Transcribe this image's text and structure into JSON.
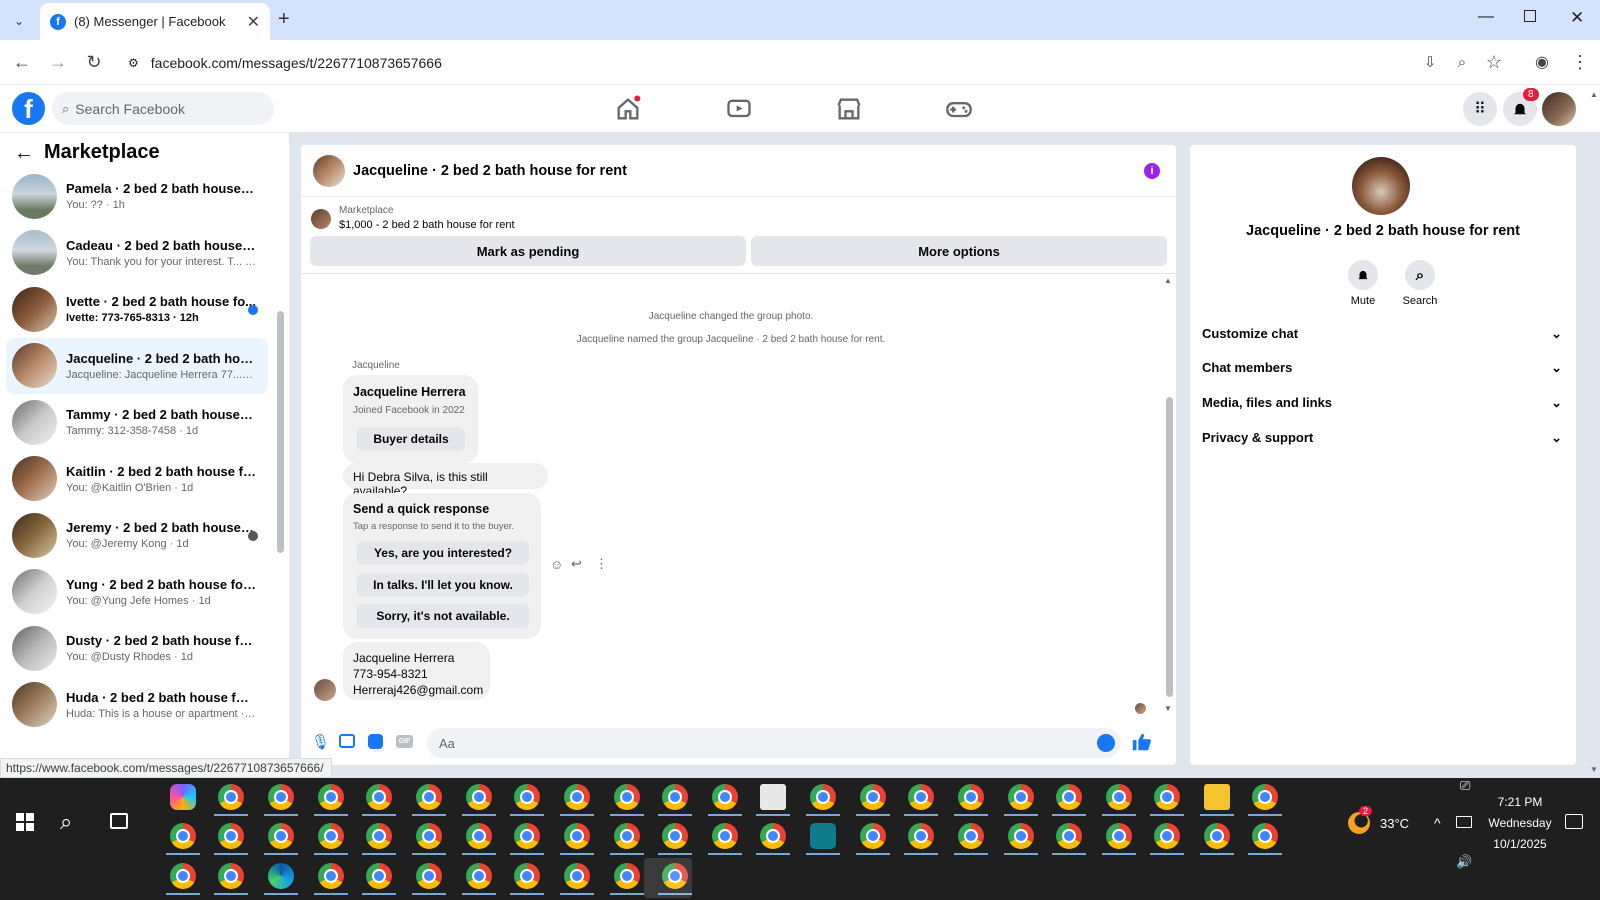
{
  "browser": {
    "tab_title": "(8) Messenger | Facebook",
    "url": "facebook.com/messages/t/2267710873657666",
    "status_url": "https://www.facebook.com/messages/t/2267710873657666/"
  },
  "fb": {
    "search_placeholder": "Search Facebook",
    "notif_count": "8"
  },
  "left": {
    "title": "Marketplace",
    "conversations": [
      {
        "name": "Pamela · 2 bed 2 bath house for...",
        "preview": "You: ?? · 1h",
        "unread": false,
        "selected": false
      },
      {
        "name": "Cadeau · 2 bed 2 bath house fo...",
        "preview": "You: Thank you for your interest. T... · 1h",
        "unread": false,
        "selected": false
      },
      {
        "name": "Ivette · 2 bed 2 bath house fo...",
        "preview": "Ivette: 773-765-8313 · 12h",
        "unread": true,
        "selected": false
      },
      {
        "name": "Jacqueline · 2 bed 2 bath house...",
        "preview": "Jacqueline: Jacqueline Herrera 77... · 18h",
        "unread": false,
        "selected": true
      },
      {
        "name": "Tammy · 2 bed 2 bath house for...",
        "preview": "Tammy: 312-358-7458 · 1d",
        "unread": false,
        "selected": false
      },
      {
        "name": "Kaitlin · 2 bed 2 bath house for ...",
        "preview": "You: @Kaitlin O'Brien · 1d",
        "unread": false,
        "selected": false
      },
      {
        "name": "Jeremy · 2 bed 2 bath house f...",
        "preview": "You: @Jeremy Kong · 1d",
        "unread": false,
        "selected": false
      },
      {
        "name": "Yung · 2 bed 2 bath house for r...",
        "preview": "You: @Yung Jefe Homes · 1d",
        "unread": false,
        "selected": false
      },
      {
        "name": "Dusty · 2 bed 2 bath house for r...",
        "preview": "You: @Dusty Rhodes · 1d",
        "unread": false,
        "selected": false
      },
      {
        "name": "Huda · 2 bed 2 bath house for r...",
        "preview": "Huda: This is a house or apartment · 1d",
        "unread": false,
        "selected": false
      }
    ]
  },
  "chat": {
    "title": "Jacqueline · 2 bed 2 bath house for rent",
    "marketplace_label": "Marketplace",
    "listing": "$1,000 - 2 bed 2 bath house for rent",
    "mark_pending": "Mark as pending",
    "more_options": "More options",
    "sys1": "Jacqueline changed the group photo.",
    "sys2": "Jacqueline named the group Jacqueline · 2 bed 2 bath house for rent.",
    "sender": "Jacqueline",
    "card_name": "Jacqueline Herrera",
    "card_joined": "Joined Facebook in 2022",
    "buyer_details": "Buyer details",
    "msg_available": "Hi Debra Silva, is this still available?",
    "quick_title": "Send a quick response",
    "quick_sub": "Tap a response to send it to the buyer.",
    "quick_1": "Yes, are you interested?",
    "quick_2": "In talks. I'll let you know.",
    "quick_3": "Sorry, it's not available.",
    "contact_name": "Jacqueline Herrera",
    "contact_phone": "773-954-8321",
    "contact_email": "Herreraj426@gmail.com",
    "compose_placeholder": "Aa"
  },
  "right": {
    "name": "Jacqueline · 2 bed 2 bath house for rent",
    "mute": "Mute",
    "search": "Search",
    "sections": [
      "Customize chat",
      "Chat members",
      "Media, files and links",
      "Privacy & support"
    ]
  },
  "taskbar": {
    "weather": "33°C",
    "weather_badge": "2",
    "time": "7:21 PM",
    "day": "Wednesday",
    "date": "10/1/2025"
  }
}
